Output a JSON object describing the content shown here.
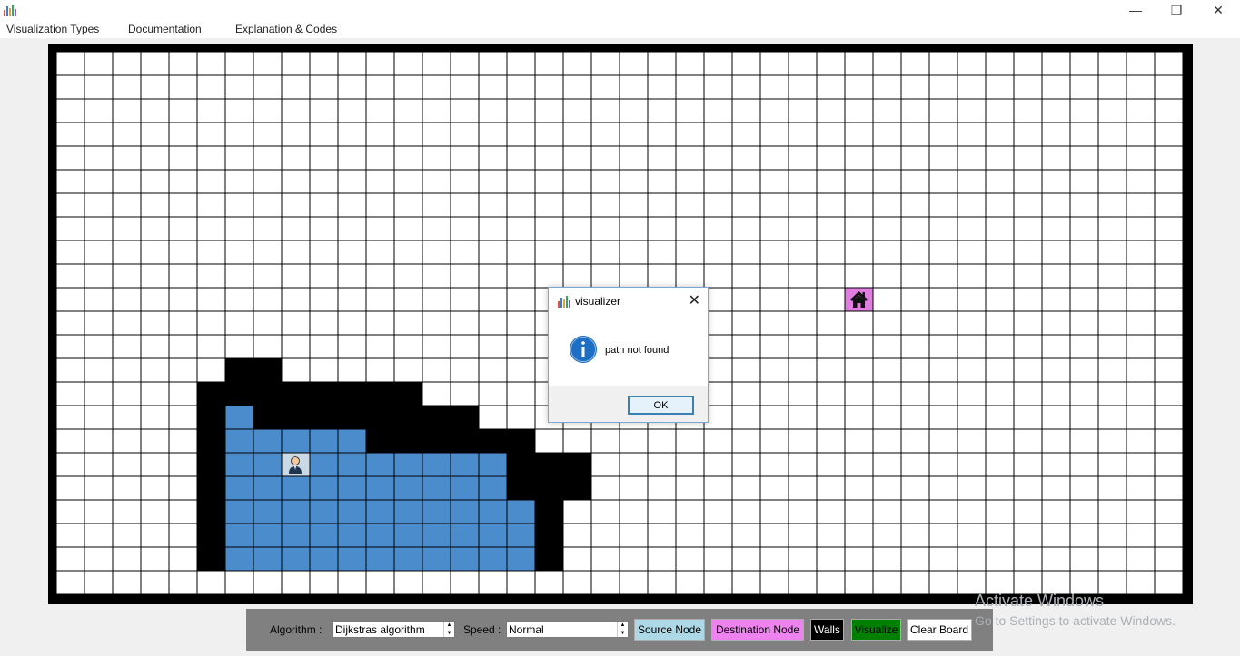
{
  "window": {
    "app_icon": "bar-chart-icon",
    "controls": {
      "minimize": "—",
      "maximize": "❐",
      "close": "✕"
    }
  },
  "menu": {
    "items": [
      "Visualization Types",
      "Documentation",
      "Explanation & Codes"
    ]
  },
  "grid": {
    "cols": 40,
    "rows": 23,
    "colors": {
      "empty": "#ffffff",
      "wall": "#000000",
      "visited": "#4a8ccc",
      "source": "#c9d9e6",
      "destination": "#e07ee0",
      "line": "#000000"
    },
    "walls": [
      [
        13,
        6
      ],
      [
        13,
        7
      ],
      [
        14,
        5
      ],
      [
        14,
        6
      ],
      [
        14,
        7
      ],
      [
        14,
        8
      ],
      [
        14,
        9
      ],
      [
        14,
        10
      ],
      [
        14,
        11
      ],
      [
        14,
        12
      ],
      [
        15,
        5
      ],
      [
        15,
        7
      ],
      [
        15,
        8
      ],
      [
        15,
        9
      ],
      [
        15,
        10
      ],
      [
        15,
        11
      ],
      [
        15,
        12
      ],
      [
        15,
        13
      ],
      [
        15,
        14
      ],
      [
        16,
        5
      ],
      [
        16,
        11
      ],
      [
        16,
        12
      ],
      [
        16,
        13
      ],
      [
        16,
        14
      ],
      [
        16,
        15
      ],
      [
        16,
        16
      ],
      [
        17,
        5
      ],
      [
        17,
        16
      ],
      [
        17,
        17
      ],
      [
        17,
        18
      ],
      [
        18,
        5
      ],
      [
        18,
        16
      ],
      [
        18,
        17
      ],
      [
        18,
        18
      ],
      [
        19,
        5
      ],
      [
        19,
        17
      ],
      [
        20,
        5
      ],
      [
        20,
        17
      ],
      [
        21,
        5
      ],
      [
        21,
        17
      ]
    ],
    "visited": [
      [
        15,
        6
      ],
      [
        16,
        6
      ],
      [
        16,
        7
      ],
      [
        16,
        8
      ],
      [
        16,
        9
      ],
      [
        16,
        10
      ],
      [
        17,
        6
      ],
      [
        17,
        7
      ],
      [
        17,
        9
      ],
      [
        17,
        10
      ],
      [
        17,
        11
      ],
      [
        17,
        12
      ],
      [
        17,
        13
      ],
      [
        17,
        14
      ],
      [
        17,
        15
      ],
      [
        18,
        6
      ],
      [
        18,
        7
      ],
      [
        18,
        8
      ],
      [
        18,
        9
      ],
      [
        18,
        10
      ],
      [
        18,
        11
      ],
      [
        18,
        12
      ],
      [
        18,
        13
      ],
      [
        18,
        14
      ],
      [
        18,
        15
      ],
      [
        19,
        6
      ],
      [
        19,
        7
      ],
      [
        19,
        8
      ],
      [
        19,
        9
      ],
      [
        19,
        10
      ],
      [
        19,
        11
      ],
      [
        19,
        12
      ],
      [
        19,
        13
      ],
      [
        19,
        14
      ],
      [
        19,
        15
      ],
      [
        19,
        16
      ],
      [
        20,
        6
      ],
      [
        20,
        7
      ],
      [
        20,
        8
      ],
      [
        20,
        9
      ],
      [
        20,
        10
      ],
      [
        20,
        11
      ],
      [
        20,
        12
      ],
      [
        20,
        13
      ],
      [
        20,
        14
      ],
      [
        20,
        15
      ],
      [
        20,
        16
      ],
      [
        21,
        6
      ],
      [
        21,
        7
      ],
      [
        21,
        8
      ],
      [
        21,
        9
      ],
      [
        21,
        10
      ],
      [
        21,
        11
      ],
      [
        21,
        12
      ],
      [
        21,
        13
      ],
      [
        21,
        14
      ],
      [
        21,
        15
      ],
      [
        21,
        16
      ]
    ],
    "source": {
      "row": 17,
      "col": 8,
      "icon": "person-icon"
    },
    "destination": {
      "row": 10,
      "col": 28,
      "icon": "house-icon"
    }
  },
  "toolbar": {
    "algorithm_label": "Algorithm :",
    "algorithm_value": "Dijkstras algorithm",
    "speed_label": "Speed :",
    "speed_value": "Normal",
    "buttons": {
      "source": {
        "label": "Source Node",
        "bg": "#add8e6",
        "fg": "#000000"
      },
      "destination": {
        "label": "Destination Node",
        "bg": "#ee82ee",
        "fg": "#000000"
      },
      "walls": {
        "label": "Walls",
        "bg": "#000000",
        "fg": "#ffffff"
      },
      "visualize": {
        "label": "Visualize",
        "bg": "#008000",
        "fg": "#000000"
      },
      "clear": {
        "label": "Clear Board",
        "bg": "#ffffff",
        "fg": "#000000"
      }
    }
  },
  "watermark": {
    "line1": "Activate Windows",
    "line2": "Go to Settings to activate Windows."
  },
  "dialog": {
    "title": "visualizer",
    "message": "path not found",
    "ok_label": "OK",
    "icon": "info-icon"
  }
}
